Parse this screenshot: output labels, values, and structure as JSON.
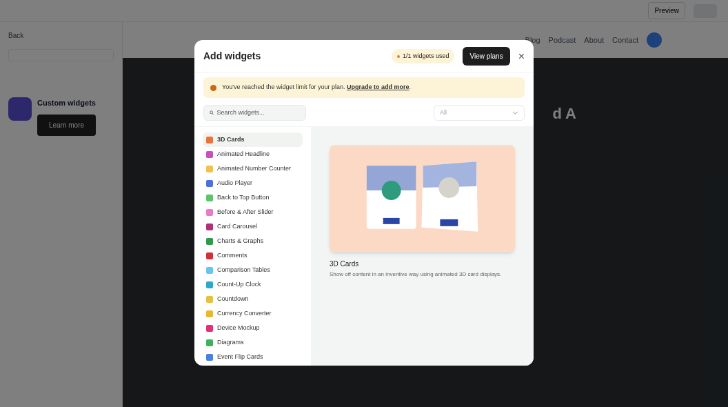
{
  "editor": {
    "back": "Back",
    "promo_title": "Custom widgets",
    "promo_button": "Learn more",
    "preview_button": "Preview",
    "nav": [
      "Blog",
      "Podcast",
      "About",
      "Contact"
    ],
    "hero_fragment": "d A"
  },
  "modal": {
    "title": "Add widgets",
    "usage": "1/1 widgets used",
    "view_plans": "View plans",
    "close": "×",
    "alert": {
      "text": "You've reached the widget limit for your plan.",
      "link": "Upgrade to add more",
      "after": "."
    },
    "search": {
      "placeholder": "Search widgets..."
    },
    "filter": {
      "value": "All"
    },
    "widgets": [
      {
        "label": "3D Cards",
        "color": "#e8743b",
        "selected": true
      },
      {
        "label": "Animated Headline",
        "color": "#c84fc0",
        "selected": false
      },
      {
        "label": "Animated Number Counter",
        "color": "#f0c050",
        "selected": false
      },
      {
        "label": "Audio Player",
        "color": "#4f6ee0",
        "selected": false
      },
      {
        "label": "Back to Top Button",
        "color": "#5cc46a",
        "selected": false
      },
      {
        "label": "Before & After Slider",
        "color": "#e87bc8",
        "selected": false
      },
      {
        "label": "Card Carousel",
        "color": "#b0307a",
        "selected": false
      },
      {
        "label": "Charts & Graphs",
        "color": "#2e9a4a",
        "selected": false
      },
      {
        "label": "Comments",
        "color": "#d0303a",
        "selected": false
      },
      {
        "label": "Comparison Tables",
        "color": "#6cc4ec",
        "selected": false
      },
      {
        "label": "Count-Up Clock",
        "color": "#2ea8c8",
        "selected": false
      },
      {
        "label": "Countdown",
        "color": "#e8c040",
        "selected": false
      },
      {
        "label": "Currency Converter",
        "color": "#e8b830",
        "selected": false
      },
      {
        "label": "Device Mockup",
        "color": "#e0307a",
        "selected": false
      },
      {
        "label": "Diagrams",
        "color": "#40b060",
        "selected": false
      },
      {
        "label": "Event Flip Cards",
        "color": "#4a80e0",
        "selected": false
      }
    ],
    "preview": {
      "kind": "picture",
      "title": "3D Cards",
      "description": "Show off content in an inventive way using animated 3D card displays."
    }
  }
}
